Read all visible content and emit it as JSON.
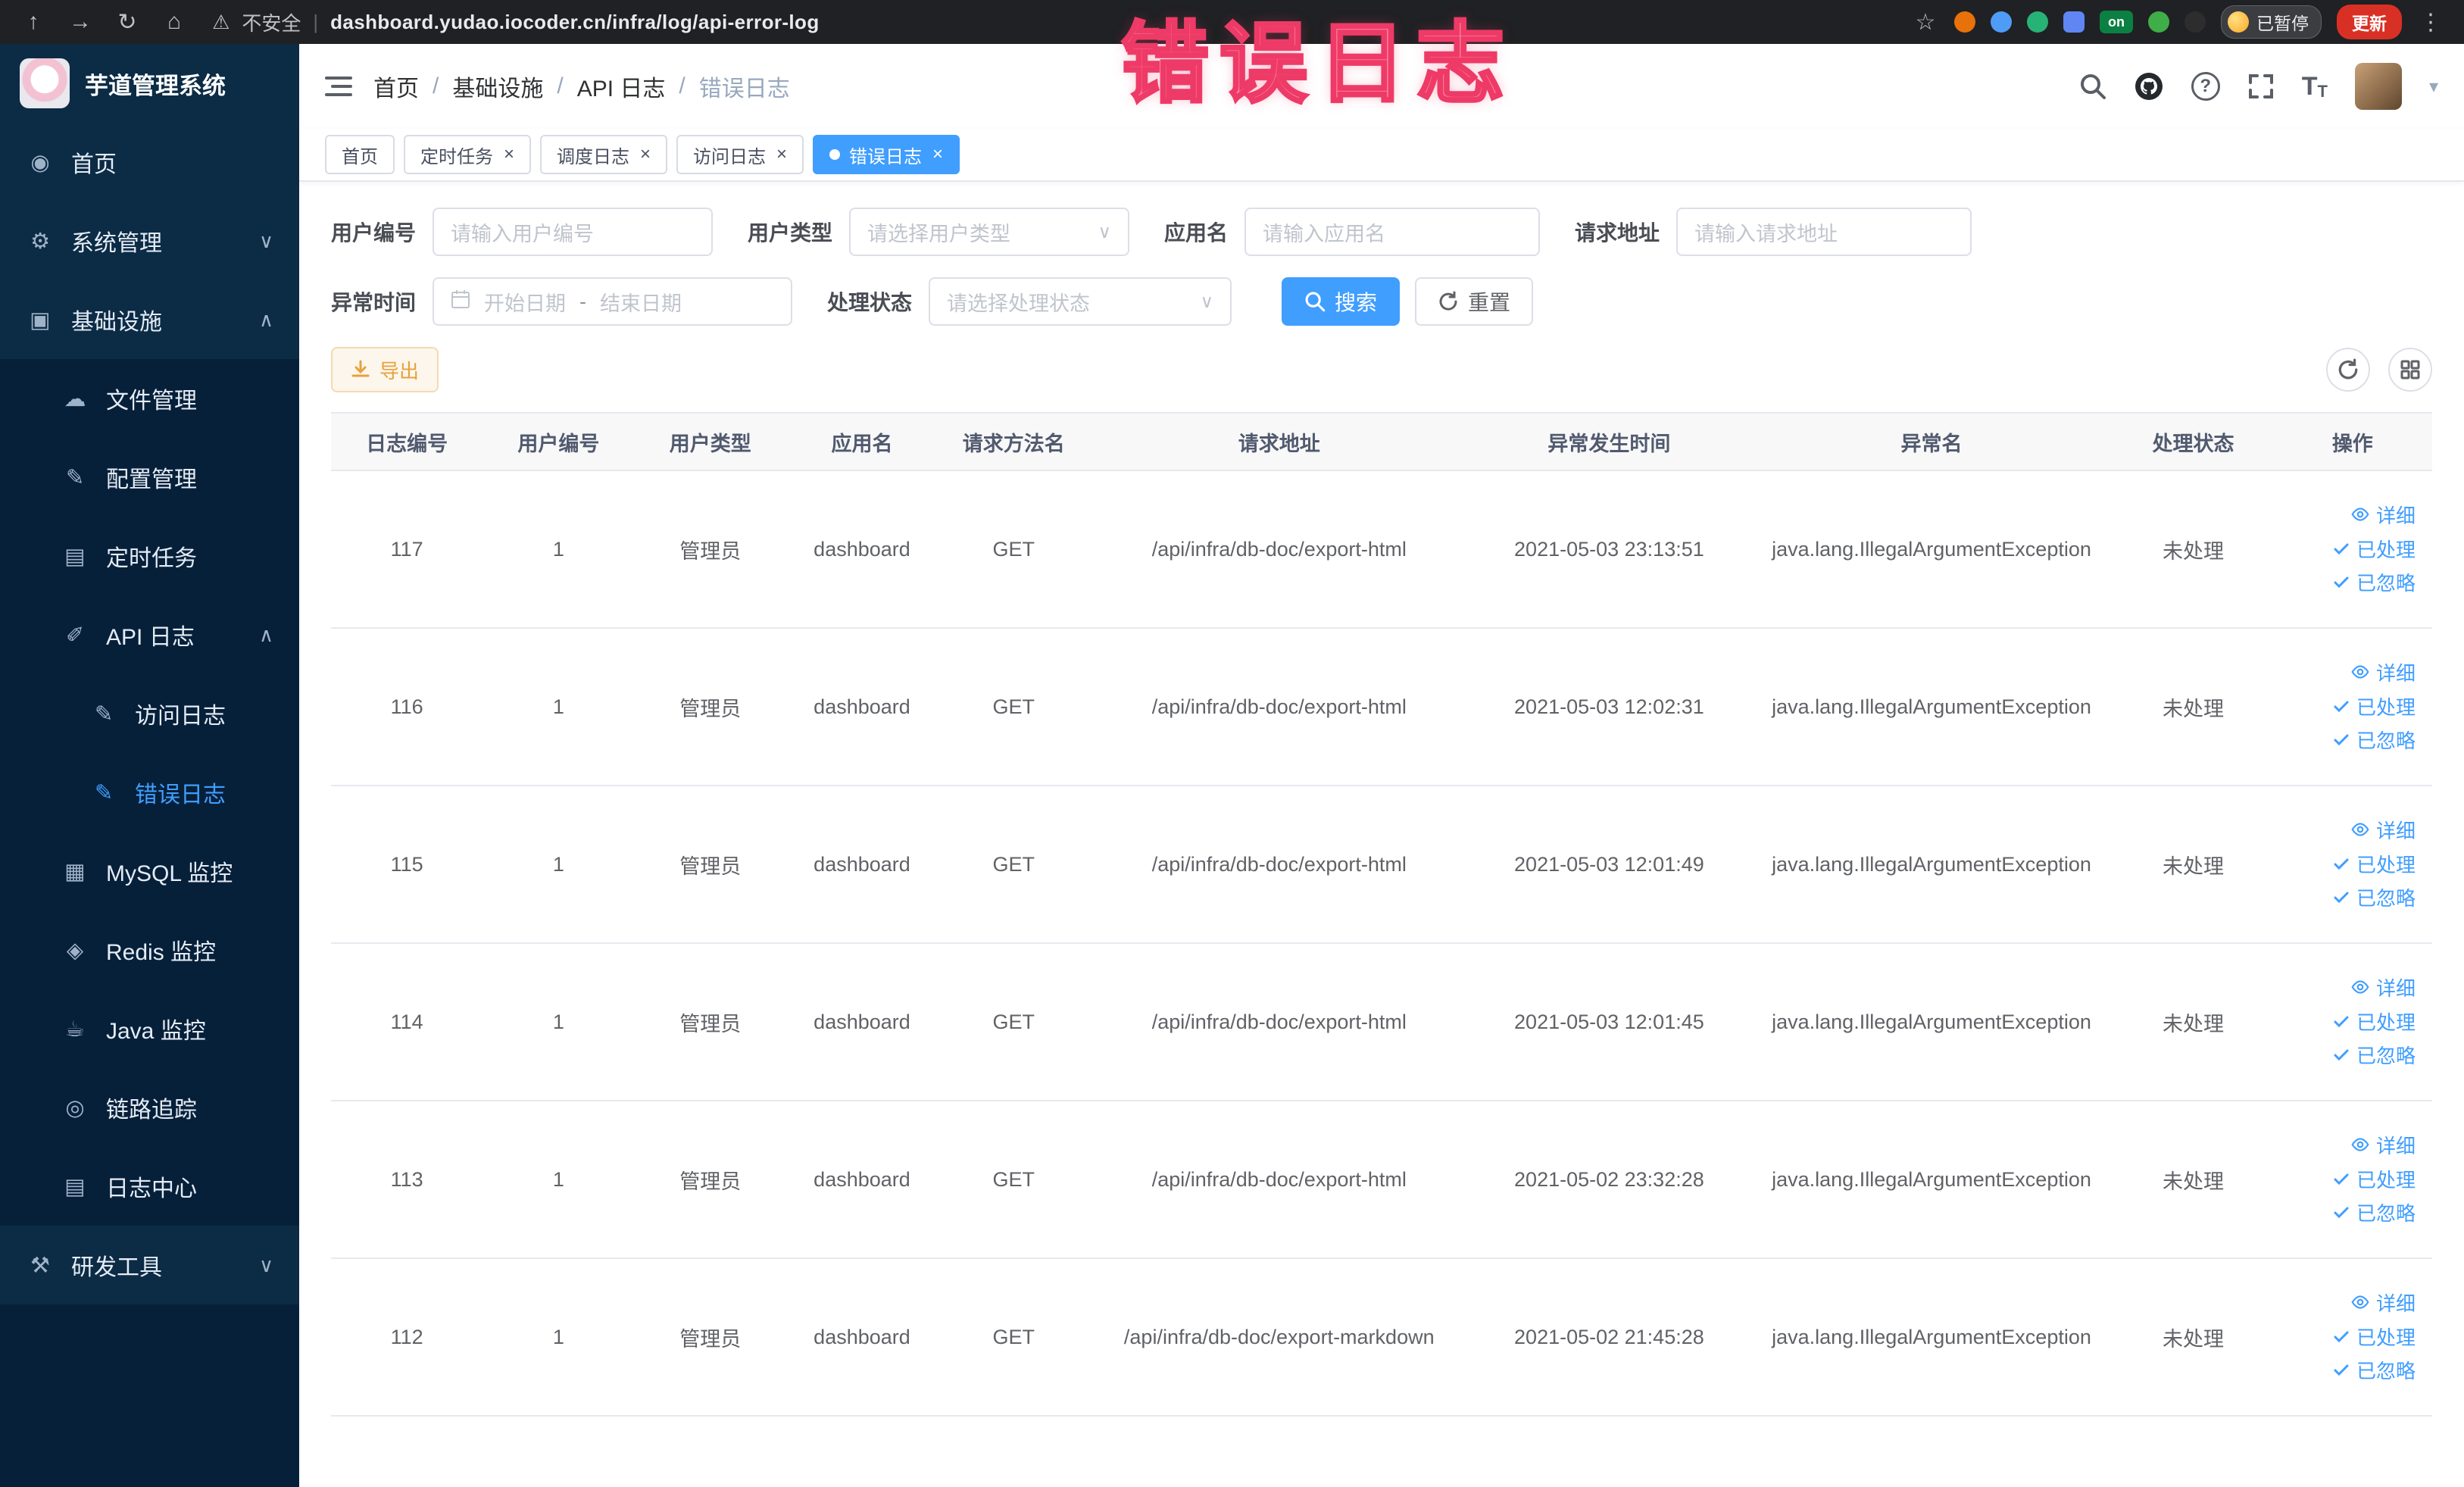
{
  "symbols": {
    "close": "×",
    "breadcrumb_sep": "/",
    "dropdown": "∨",
    "date_sep": "-",
    "url_sep": "|",
    "question": "?"
  },
  "icons": {
    "share": "↑",
    "forward": "→",
    "reload": "↻",
    "home": "⌂",
    "warning": "⚠",
    "star": "☆",
    "kebab": "⋮",
    "caret_down": "▾",
    "font_large": "T",
    "font_small": "T"
  },
  "annotation": {
    "text": "错误日志",
    "color": "#ee3a67"
  },
  "browser": {
    "security_label": "不安全",
    "url": "dashboard.yudao.iocoder.cn/infra/log/api-error-log",
    "on_badge": "on",
    "paused_badge": "已暂停",
    "update_button": "更新"
  },
  "sidebar": {
    "logo_title": "芋道管理系统",
    "items": [
      {
        "id": "home",
        "label": "首页",
        "icon": "◉",
        "level": 1
      },
      {
        "id": "system",
        "label": "系统管理",
        "icon": "⚙",
        "level": 1,
        "chevron": "∨"
      },
      {
        "id": "infra",
        "label": "基础设施",
        "icon": "▣",
        "level": 1,
        "chevron": "∧"
      },
      {
        "id": "file",
        "label": "文件管理",
        "icon": "☁",
        "level": 2,
        "sub": true
      },
      {
        "id": "config",
        "label": "配置管理",
        "icon": "✎",
        "level": 2,
        "sub": true
      },
      {
        "id": "job",
        "label": "定时任务",
        "icon": "▤",
        "level": 2,
        "sub": true
      },
      {
        "id": "api-log",
        "label": "API 日志",
        "icon": "✐",
        "level": 2,
        "sub": true,
        "chevron": "∧"
      },
      {
        "id": "access-log",
        "label": "访问日志",
        "icon": "✎",
        "level": 3,
        "sub": true
      },
      {
        "id": "error-log",
        "label": "错误日志",
        "icon": "✎",
        "level": 3,
        "sub": true,
        "active": true
      },
      {
        "id": "mysql",
        "label": "MySQL 监控",
        "icon": "▦",
        "level": 2,
        "sub": true
      },
      {
        "id": "redis",
        "label": "Redis 监控",
        "icon": "◈",
        "level": 2,
        "sub": true
      },
      {
        "id": "java",
        "label": "Java 监控",
        "icon": "☕",
        "level": 2,
        "sub": true
      },
      {
        "id": "tracer",
        "label": "链路追踪",
        "icon": "◎",
        "level": 2,
        "sub": true
      },
      {
        "id": "log-center",
        "label": "日志中心",
        "icon": "▤",
        "level": 2,
        "sub": true
      },
      {
        "id": "dev-tools",
        "label": "研发工具",
        "icon": "⚒",
        "level": 1,
        "chevron": "∨"
      }
    ]
  },
  "header": {
    "breadcrumb": [
      "首页",
      "基础设施",
      "API 日志",
      "错误日志"
    ]
  },
  "tabs": [
    {
      "id": "home",
      "label": "首页"
    },
    {
      "id": "job",
      "label": "定时任务",
      "closable": true
    },
    {
      "id": "job-log",
      "label": "调度日志",
      "closable": true
    },
    {
      "id": "access-log",
      "label": "访问日志",
      "closable": true
    },
    {
      "id": "error-log",
      "label": "错误日志",
      "closable": true,
      "active": true
    }
  ],
  "filters": {
    "user_id": {
      "label": "用户编号",
      "placeholder": "请输入用户编号"
    },
    "user_type": {
      "label": "用户类型",
      "placeholder": "请选择用户类型"
    },
    "app_name": {
      "label": "应用名",
      "placeholder": "请输入应用名"
    },
    "request_url": {
      "label": "请求地址",
      "placeholder": "请输入请求地址"
    },
    "exception_time": {
      "label": "异常时间",
      "start_placeholder": "开始日期",
      "end_placeholder": "结束日期"
    },
    "process_status": {
      "label": "处理状态",
      "placeholder": "请选择处理状态"
    },
    "search_button": "搜索",
    "reset_button": "重置"
  },
  "toolbar": {
    "export_button": "导出"
  },
  "table": {
    "headers": [
      "日志编号",
      "用户编号",
      "用户类型",
      "应用名",
      "请求方法名",
      "请求地址",
      "异常发生时间",
      "异常名",
      "处理状态",
      "操作"
    ],
    "action_labels": [
      "详细",
      "已处理",
      "已忽略"
    ],
    "rows": [
      {
        "log_id": "117",
        "user_id": "1",
        "user_type": "管理员",
        "app_name": "dashboard",
        "method": "GET",
        "request_url": "/api/infra/db-doc/export-html",
        "exception_time": "2021-05-03 23:13:51",
        "exception_name": "java.lang.IllegalArgumentException",
        "status": "未处理"
      },
      {
        "log_id": "116",
        "user_id": "1",
        "user_type": "管理员",
        "app_name": "dashboard",
        "method": "GET",
        "request_url": "/api/infra/db-doc/export-html",
        "exception_time": "2021-05-03 12:02:31",
        "exception_name": "java.lang.IllegalArgumentException",
        "status": "未处理"
      },
      {
        "log_id": "115",
        "user_id": "1",
        "user_type": "管理员",
        "app_name": "dashboard",
        "method": "GET",
        "request_url": "/api/infra/db-doc/export-html",
        "exception_time": "2021-05-03 12:01:49",
        "exception_name": "java.lang.IllegalArgumentException",
        "status": "未处理"
      },
      {
        "log_id": "114",
        "user_id": "1",
        "user_type": "管理员",
        "app_name": "dashboard",
        "method": "GET",
        "request_url": "/api/infra/db-doc/export-html",
        "exception_time": "2021-05-03 12:01:45",
        "exception_name": "java.lang.IllegalArgumentException",
        "status": "未处理"
      },
      {
        "log_id": "113",
        "user_id": "1",
        "user_type": "管理员",
        "app_name": "dashboard",
        "method": "GET",
        "request_url": "/api/infra/db-doc/export-html",
        "exception_time": "2021-05-02 23:32:28",
        "exception_name": "java.lang.IllegalArgumentException",
        "status": "未处理"
      },
      {
        "log_id": "112",
        "user_id": "1",
        "user_type": "管理员",
        "app_name": "dashboard",
        "method": "GET",
        "request_url": "/api/infra/db-doc/export-markdown",
        "exception_time": "2021-05-02 21:45:28",
        "exception_name": "java.lang.IllegalArgumentException",
        "status": "未处理"
      }
    ]
  },
  "colors": {
    "accent": "#409eff",
    "warning": "#e6a23c",
    "sidebar_bg": "#0c2b45",
    "chrome_bg": "#202124"
  }
}
